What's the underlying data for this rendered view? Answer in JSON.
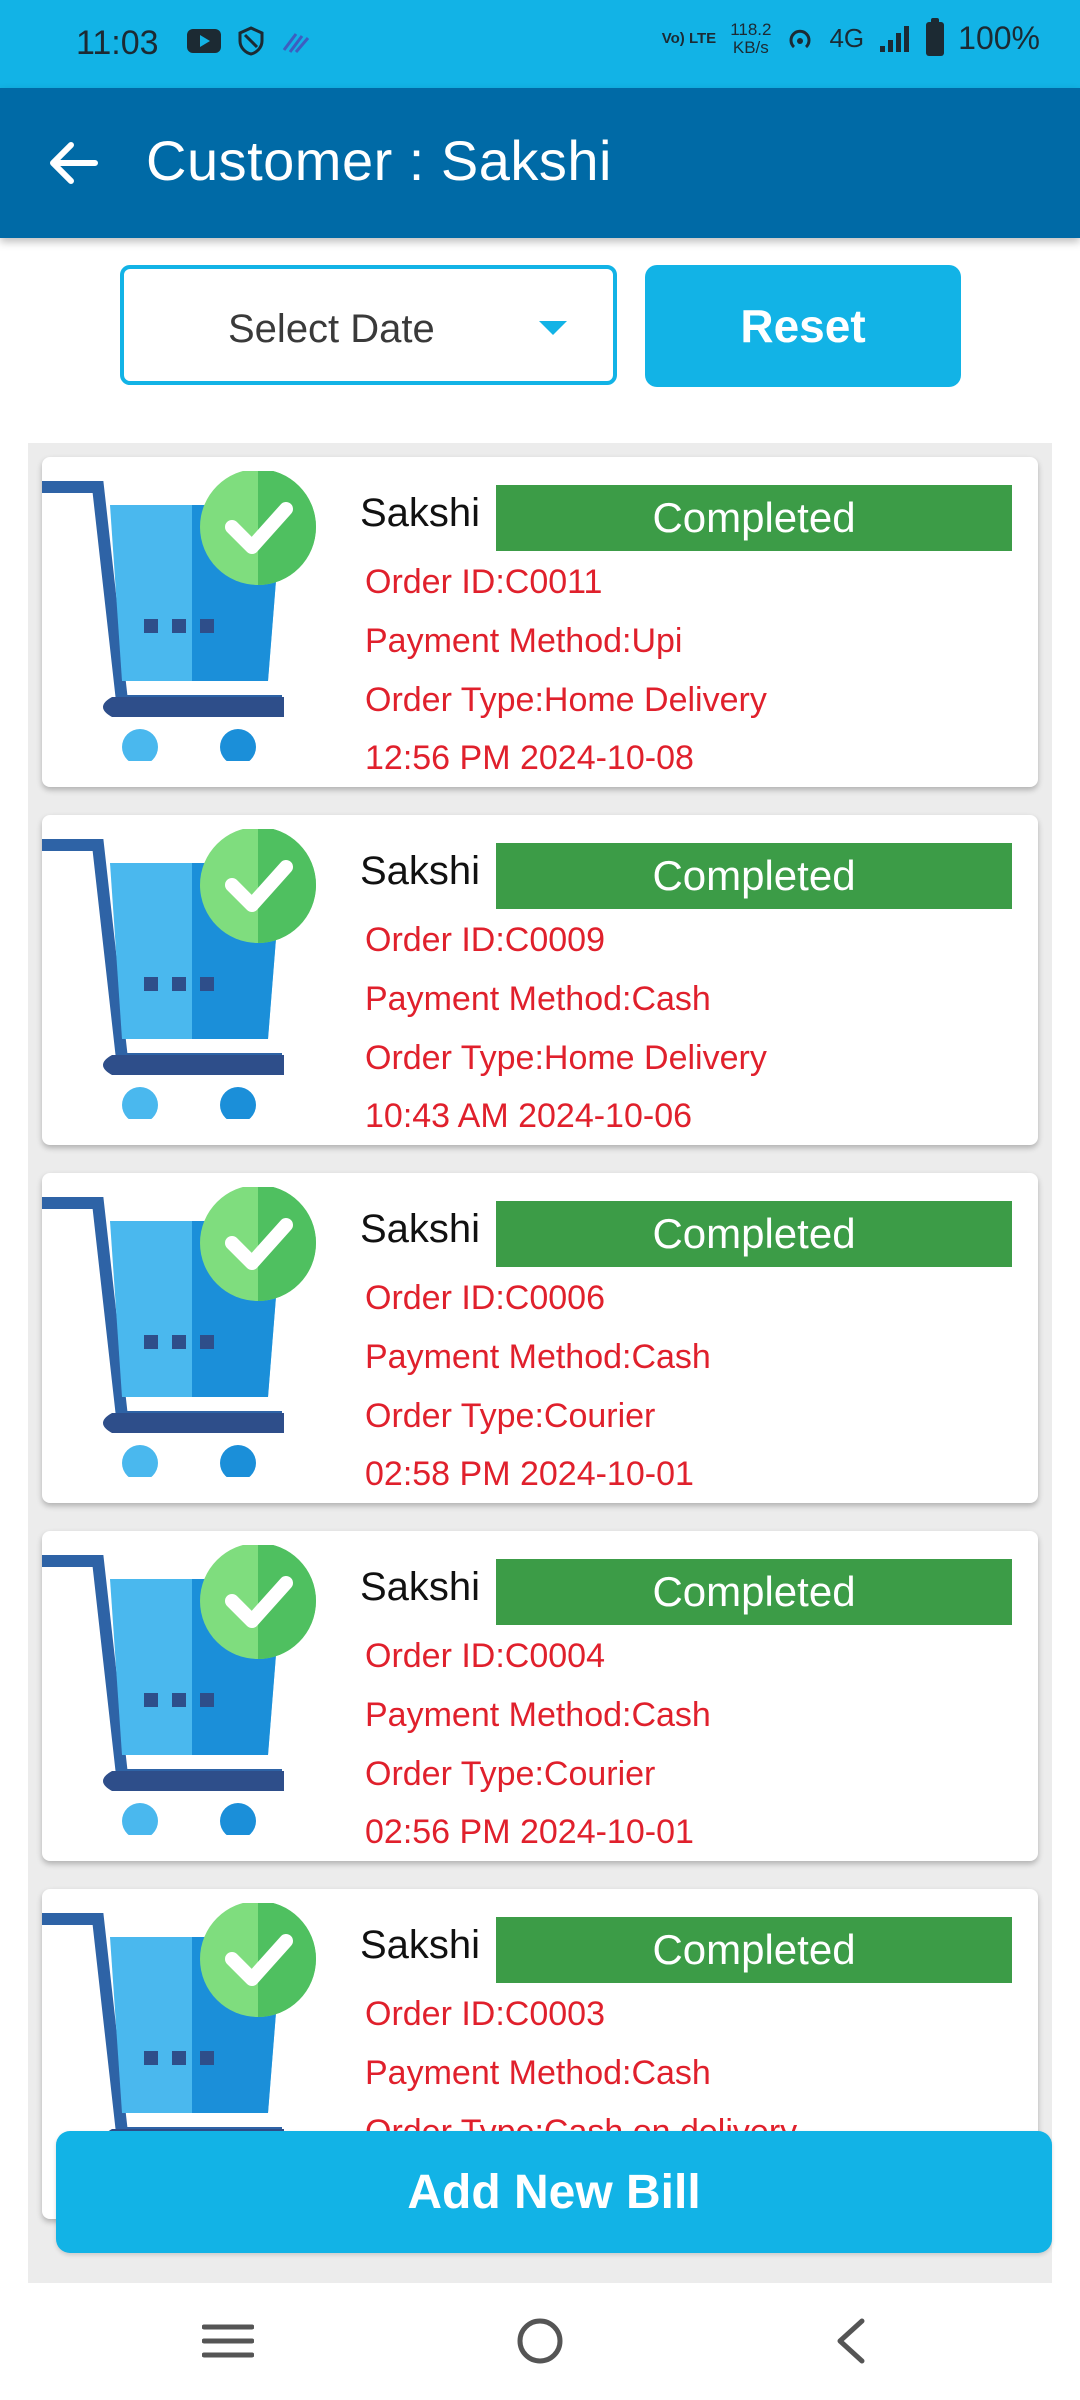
{
  "status_bar": {
    "time": "11:03",
    "network_lte": "Vo) LTE",
    "speed_value": "118.2",
    "speed_unit": "KB/s",
    "network_type": "4G",
    "battery": "100%"
  },
  "header": {
    "title": "Customer : Sakshi",
    "back_icon": "arrow-left-icon"
  },
  "filters": {
    "date_placeholder": "Select Date",
    "reset_label": "Reset"
  },
  "orders": [
    {
      "customer": "Sakshi",
      "status": "Completed",
      "order_id": "Order ID:C0011",
      "payment": "Payment Method:Upi",
      "type": "Order Type:Home Delivery",
      "datetime": "12:56 PM 2024-10-08"
    },
    {
      "customer": "Sakshi",
      "status": "Completed",
      "order_id": "Order ID:C0009",
      "payment": "Payment Method:Cash",
      "type": "Order Type:Home Delivery",
      "datetime": "10:43 AM 2024-10-06"
    },
    {
      "customer": "Sakshi",
      "status": "Completed",
      "order_id": "Order ID:C0006",
      "payment": "Payment Method:Cash",
      "type": "Order Type:Courier",
      "datetime": "02:58 PM 2024-10-01"
    },
    {
      "customer": "Sakshi",
      "status": "Completed",
      "order_id": "Order ID:C0004",
      "payment": "Payment Method:Cash",
      "type": "Order Type:Courier",
      "datetime": "02:56 PM 2024-10-01"
    },
    {
      "customer": "Sakshi",
      "status": "Completed",
      "order_id": "Order ID:C0003",
      "payment": "Payment Method:Cash",
      "type": "Order Type:Cash on delivery",
      "datetime": ""
    }
  ],
  "actions": {
    "add_bill_label": "Add New Bill"
  },
  "colors": {
    "primary": "#12b3e6",
    "header": "#006aa6",
    "status_completed": "#3c9c47",
    "detail_text": "#e0202c"
  },
  "nav": {
    "recents_icon": "recents-icon",
    "home_icon": "home-icon",
    "back_icon": "back-chevron-icon"
  }
}
